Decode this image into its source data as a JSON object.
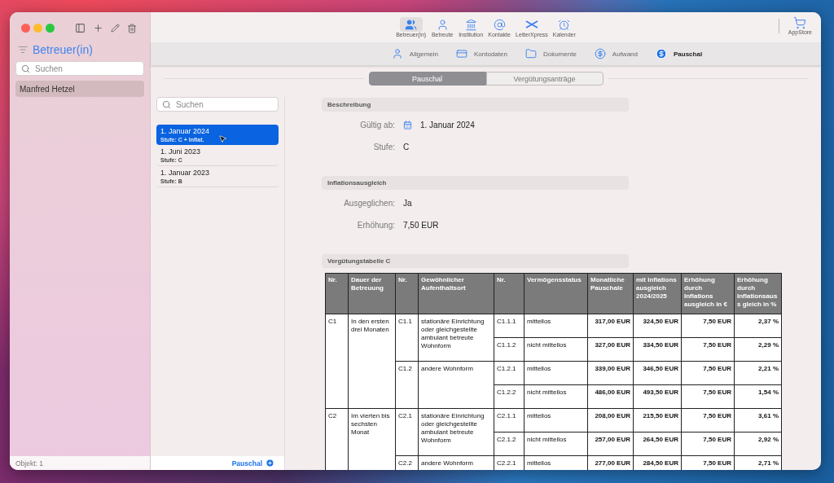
{
  "sidebar": {
    "title": "Betreuer(in)",
    "search": {
      "placeholder": "Suchen"
    },
    "items": [
      {
        "label": "Manfred Hetzel",
        "selected": true
      }
    ],
    "status": "Objekt: 1"
  },
  "toolbar": {
    "items": [
      {
        "label": "Betreuer(in)",
        "kind": "group",
        "selected": true
      },
      {
        "label": "Betreute",
        "kind": "person",
        "selected": false
      },
      {
        "label": "Institution",
        "kind": "building",
        "selected": false
      },
      {
        "label": "Kontakte",
        "kind": "contacts",
        "selected": false
      },
      {
        "label": "LetterXpress",
        "kind": "cross",
        "selected": false
      },
      {
        "label": "Kalender",
        "kind": "clock",
        "selected": false
      }
    ],
    "store": {
      "label": "AppStore"
    }
  },
  "subtabs": [
    {
      "label": "Allgemein",
      "kind": "person",
      "selected": false
    },
    {
      "label": "Kontodaten",
      "kind": "card",
      "selected": false
    },
    {
      "label": "Dokumente",
      "kind": "folder",
      "selected": false
    },
    {
      "label": "Aufwand",
      "kind": "coin",
      "selected": false
    },
    {
      "label": "Pauschal",
      "kind": "coin",
      "selected": true
    }
  ],
  "segments": [
    {
      "label": "Pauschal",
      "selected": true
    },
    {
      "label": "Vergütungsanträge",
      "selected": false
    }
  ],
  "entries": {
    "search": {
      "placeholder": "Suchen"
    },
    "items": [
      {
        "title": "1. Januar 2024",
        "subtitle": "Stufe: C + Inflat.",
        "selected": true
      },
      {
        "title": "1. Juni 2023",
        "subtitle": "Stufe: C",
        "selected": false
      },
      {
        "title": "1. Januar 2023",
        "subtitle": "Stufe: B",
        "selected": false
      }
    ],
    "add_label": "Pauschal"
  },
  "detail": {
    "sections": [
      {
        "title": "Beschreibung",
        "fields": [
          {
            "label": "Gültig ab:",
            "value": "1. Januar 2024",
            "kind": "date"
          },
          {
            "label": "Stufe:",
            "value": "C",
            "kind": "text"
          }
        ]
      },
      {
        "title": "Inflationsausgleich",
        "fields": [
          {
            "label": "Ausgeglichen:",
            "value": "Ja",
            "kind": "text"
          },
          {
            "label": "Erhöhung:",
            "value": "7,50 EUR",
            "kind": "text"
          }
        ]
      }
    ],
    "table": {
      "title": "Vergütungstabelle C",
      "columns": [
        "Nr.",
        "Dauer der Betreuung",
        "Nr.",
        "Gewöhnlicher Aufenthaltsort",
        "Nr.",
        "Vermögensstatus",
        "Monatliche Pauschale",
        "mit Inflations ausgleich 2024/2025",
        "Erhöhung durch Inflations ausgleich in €",
        "Erhöhung durch Inflationsaus s gleich in %"
      ],
      "groups": [
        {
          "nr": "C1",
          "duration": "In den ersten drei Monaten",
          "places": [
            {
              "nr": "C1.1",
              "name": "stationäre Einrichtung oder gleichgestellte ambulant betreute Wohnform",
              "rows": [
                {
                  "nr": "C1.1.1",
                  "status": "mittellos",
                  "monthly": "317,00 EUR",
                  "with_inflation": "324,50 EUR",
                  "increase": "7,50 EUR",
                  "percent": "2,37 %"
                },
                {
                  "nr": "C1.1.2",
                  "status": "nicht mittellos",
                  "monthly": "327,00 EUR",
                  "with_inflation": "334,50 EUR",
                  "increase": "7,50 EUR",
                  "percent": "2,29 %"
                }
              ]
            },
            {
              "nr": "C1.2",
              "name": "andere Wohnform",
              "rows": [
                {
                  "nr": "C1.2.1",
                  "status": "mittellos",
                  "monthly": "339,00 EUR",
                  "with_inflation": "346,50 EUR",
                  "increase": "7,50 EUR",
                  "percent": "2,21 %"
                },
                {
                  "nr": "C1.2.2",
                  "status": "nicht mittellos",
                  "monthly": "486,00 EUR",
                  "with_inflation": "493,50 EUR",
                  "increase": "7,50 EUR",
                  "percent": "1,54 %"
                }
              ]
            }
          ]
        },
        {
          "nr": "C2",
          "duration": "Im vierten bis sechsten Monat",
          "places": [
            {
              "nr": "C2.1",
              "name": "stationäre Einrichtung oder gleichgestellte ambulant betreute Wohnform",
              "rows": [
                {
                  "nr": "C2.1.1",
                  "status": "mittellos",
                  "monthly": "208,00 EUR",
                  "with_inflation": "215,50 EUR",
                  "increase": "7,50 EUR",
                  "percent": "3,61 %"
                },
                {
                  "nr": "C2.1.2",
                  "status": "nicht mittellos",
                  "monthly": "257,00 EUR",
                  "with_inflation": "264,50 EUR",
                  "increase": "7,50 EUR",
                  "percent": "2,92 %"
                }
              ]
            },
            {
              "nr": "C2.2",
              "name": "andere Wohnform",
              "rows": [
                {
                  "nr": "C2.2.1",
                  "status": "mittellos",
                  "monthly": "277,00 EUR",
                  "with_inflation": "284,50 EUR",
                  "increase": "7,50 EUR",
                  "percent": "2,71 %"
                }
              ]
            }
          ]
        }
      ]
    }
  }
}
